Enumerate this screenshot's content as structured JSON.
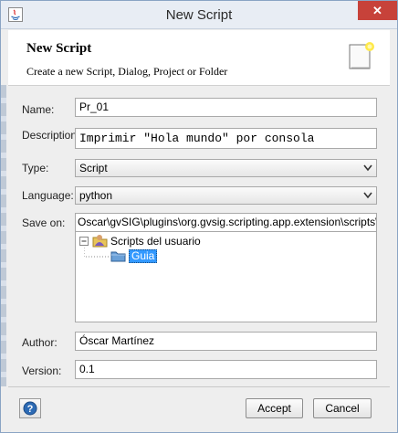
{
  "window": {
    "title": "New Script",
    "close_glyph": "✕"
  },
  "header": {
    "title": "New Script",
    "subtitle": "Create a new Script, Dialog, Project or Folder"
  },
  "form": {
    "name_label": "Name:",
    "name_value": "Pr_01",
    "description_label": "Description:",
    "description_value": "Imprimir \"Hola mundo\" por consola",
    "type_label": "Type:",
    "type_value": "Script",
    "language_label": "Language:",
    "language_value": "python",
    "save_on_label": "Save on:",
    "save_on_value": "Oscar\\gvSIG\\plugins\\org.gvsig.scripting.app.extension\\scripts\\Guia",
    "author_label": "Author:",
    "author_value": "Óscar Martínez",
    "version_label": "Version:",
    "version_value": "0.1"
  },
  "tree": {
    "root": {
      "label": "Scripts del usuario",
      "expand_glyph": "−"
    },
    "child": {
      "label": "Guia"
    }
  },
  "buttons": {
    "accept": "Accept",
    "cancel": "Cancel"
  },
  "colors": {
    "selection": "#3399ff",
    "close": "#c7423a",
    "folder": "#6aa0d8"
  }
}
